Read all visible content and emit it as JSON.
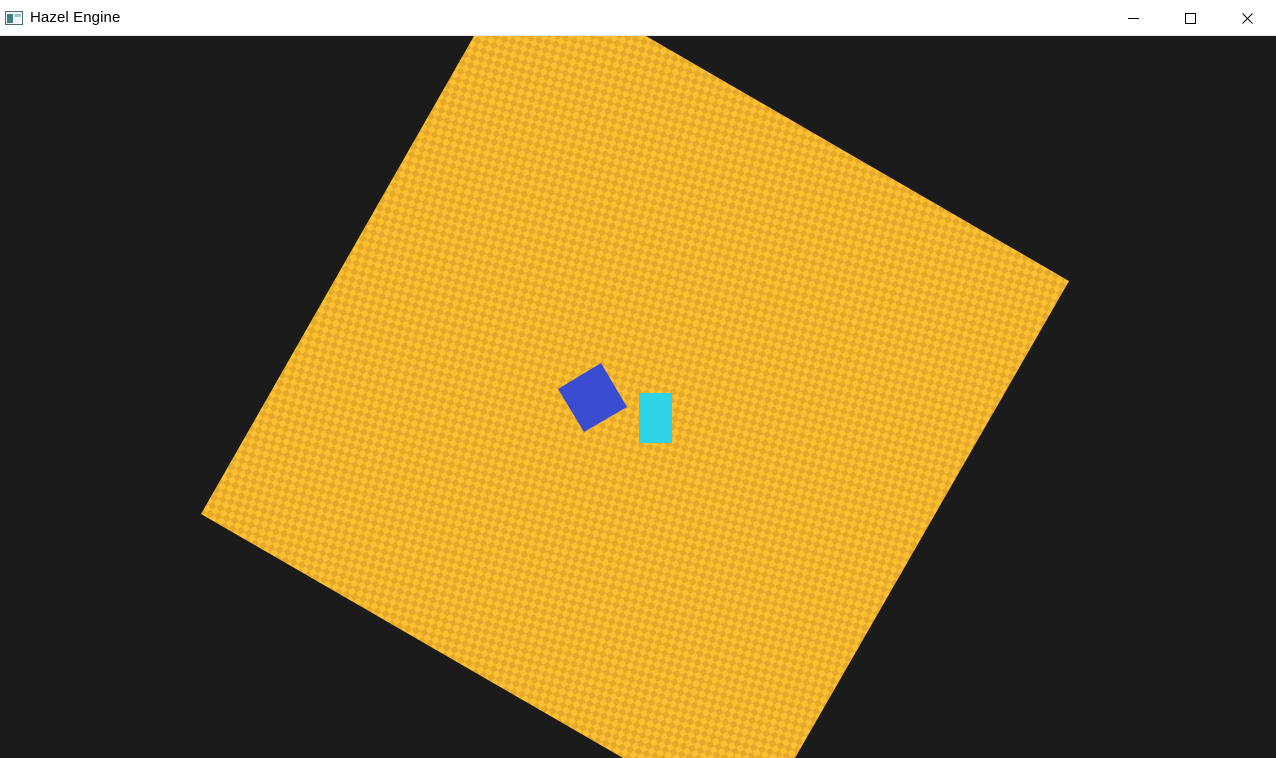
{
  "window": {
    "title": "Hazel Engine",
    "icons": {
      "app": "app-window-icon",
      "minimize": "minimize-icon",
      "maximize": "maximize-icon",
      "close": "close-icon"
    }
  },
  "scene": {
    "clear_color": "#1b1b1b",
    "checkerboard": {
      "color_light": "#fcc032",
      "color_dark": "#e6a92a"
    },
    "blue_quad_color": "#3a4ccf",
    "cyan_quad_color": "#2ed3e8"
  }
}
